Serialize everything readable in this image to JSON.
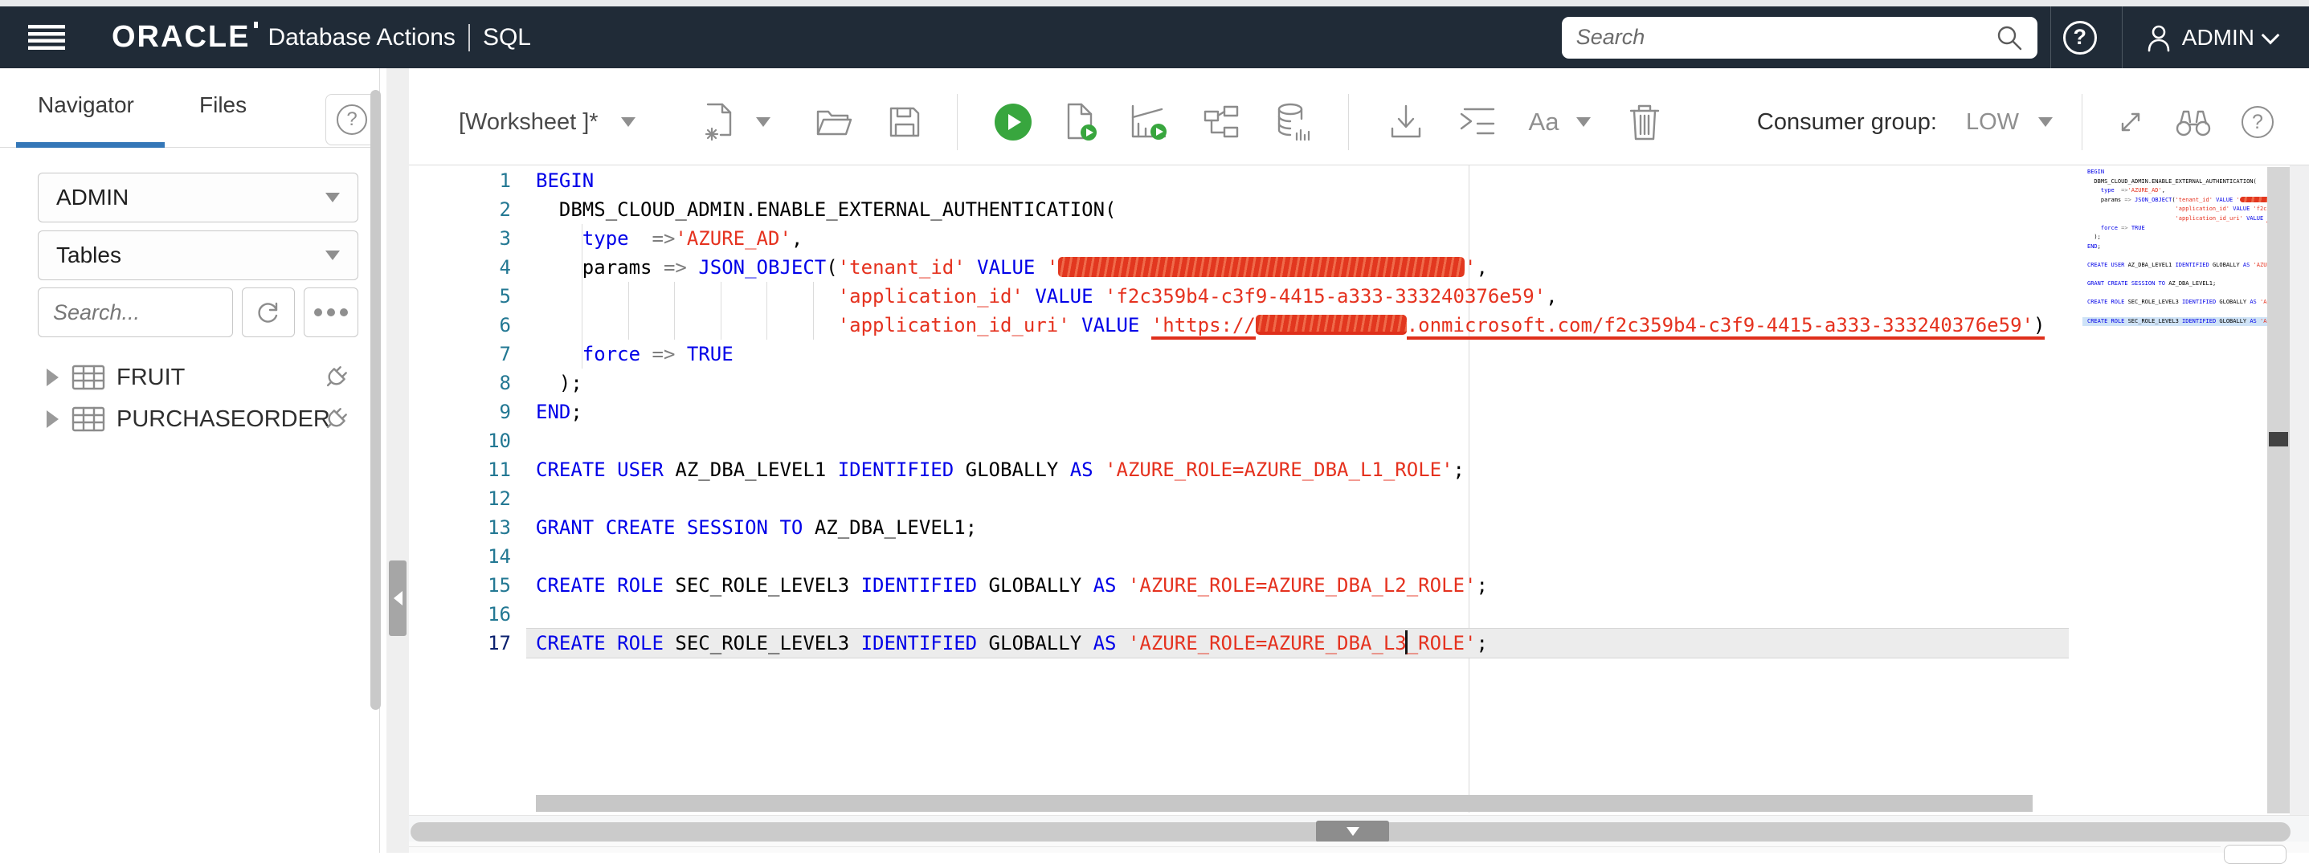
{
  "colors": {
    "header_bg": "#202b37",
    "tab_accent_blue": "#3477b8",
    "run_green": "#38a63e",
    "syntax_keyword": "#0000e8",
    "syntax_string": "#e5321f",
    "syntax_operator": "#7e7e7e",
    "line_number": "#237893",
    "line_number_active": "#0b216f",
    "redaction_red": "#e2371f",
    "current_line_bg": "#ececec"
  },
  "icons": {
    "question": "?"
  },
  "header": {
    "brand": "ORACLE",
    "app_title": "Database Actions",
    "section": "SQL",
    "search_placeholder": "Search",
    "user": "ADMIN"
  },
  "sidebar": {
    "tabs": [
      {
        "label": "Navigator"
      },
      {
        "label": "Files"
      }
    ],
    "schema": "ADMIN",
    "object_type": "Tables",
    "search_placeholder": "Search...",
    "tree": [
      {
        "label": "FRUIT"
      },
      {
        "label": "PURCHASEORDER"
      }
    ]
  },
  "toolbar": {
    "worksheet_label": "[Worksheet ]*",
    "font_size_label": "Aa",
    "consumer_group_label": "Consumer group:",
    "consumer_group_value": "LOW"
  },
  "editor": {
    "active_line": 17,
    "lines": [
      [
        [
          "kw",
          "BEGIN"
        ]
      ],
      [
        [
          "pl",
          "  DBMS_CLOUD_ADMIN.ENABLE_EXTERNAL_AUTHENTICATION("
        ]
      ],
      [
        [
          "pl",
          "    "
        ],
        [
          "kw",
          "type"
        ],
        [
          "pl",
          "  "
        ],
        [
          "op",
          "=>"
        ],
        [
          "str",
          "'AZURE_AD'"
        ],
        [
          "pl",
          ","
        ]
      ],
      [
        [
          "pl",
          "    params "
        ],
        [
          "op",
          "=>"
        ],
        [
          "pl",
          " "
        ],
        [
          "kw",
          "JSON_OBJECT"
        ],
        [
          "pl",
          "("
        ],
        [
          "str",
          "'tenant_id'"
        ],
        [
          "pl",
          " "
        ],
        [
          "kw",
          "VALUE"
        ],
        [
          "pl",
          " "
        ],
        [
          "str",
          "'"
        ],
        [
          "redact",
          "35"
        ],
        [
          "str",
          "'"
        ],
        [
          "pl",
          ","
        ]
      ],
      [
        [
          "pl",
          "                          "
        ],
        [
          "str",
          "'application_id'"
        ],
        [
          "pl",
          " "
        ],
        [
          "kw",
          "VALUE"
        ],
        [
          "pl",
          " "
        ],
        [
          "str",
          "'f2c359b4-c3f9-4415-a333-333240376e59'"
        ],
        [
          "pl",
          ","
        ]
      ],
      [
        [
          "pl",
          "                          "
        ],
        [
          "str",
          "'application_id_uri'"
        ],
        [
          "pl",
          " "
        ],
        [
          "kw",
          "VALUE"
        ],
        [
          "pl",
          " "
        ],
        [
          "str",
          "'https://",
          "u"
        ],
        [
          "redact",
          "13",
          "u"
        ],
        [
          "str",
          ".onmicrosoft.com/f2c359b4-c3f9-4415-a333-333240376e59'",
          "u"
        ],
        [
          "pl",
          ")",
          "u"
        ]
      ],
      [
        [
          "pl",
          "    "
        ],
        [
          "kw",
          "force"
        ],
        [
          "pl",
          " "
        ],
        [
          "op",
          "=>"
        ],
        [
          "pl",
          " "
        ],
        [
          "kw",
          "TRUE"
        ]
      ],
      [
        [
          "pl",
          "  );"
        ]
      ],
      [
        [
          "kw",
          "END"
        ],
        [
          "pl",
          ";"
        ]
      ],
      [],
      [
        [
          "kw",
          "CREATE"
        ],
        [
          "pl",
          " "
        ],
        [
          "kw",
          "USER"
        ],
        [
          "pl",
          " AZ_DBA_LEVEL1 "
        ],
        [
          "kw",
          "IDENTIFIED"
        ],
        [
          "pl",
          " GLOBALLY "
        ],
        [
          "kw",
          "AS"
        ],
        [
          "pl",
          " "
        ],
        [
          "str",
          "'AZURE_ROLE=AZURE_DBA_L1_ROLE'"
        ],
        [
          "pl",
          ";"
        ]
      ],
      [],
      [
        [
          "kw",
          "GRANT"
        ],
        [
          "pl",
          " "
        ],
        [
          "kw",
          "CREATE"
        ],
        [
          "pl",
          " "
        ],
        [
          "kw",
          "SESSION"
        ],
        [
          "pl",
          " "
        ],
        [
          "kw",
          "TO"
        ],
        [
          "pl",
          " AZ_DBA_LEVEL1;"
        ]
      ],
      [],
      [
        [
          "kw",
          "CREATE"
        ],
        [
          "pl",
          " "
        ],
        [
          "kw",
          "ROLE"
        ],
        [
          "pl",
          " SEC_ROLE_LEVEL3 "
        ],
        [
          "kw",
          "IDENTIFIED"
        ],
        [
          "pl",
          " GLOBALLY "
        ],
        [
          "kw",
          "AS"
        ],
        [
          "pl",
          " "
        ],
        [
          "str",
          "'AZURE_ROLE=AZURE_DBA_L2_ROLE'"
        ],
        [
          "pl",
          ";"
        ]
      ],
      [],
      [
        [
          "kw",
          "CREATE"
        ],
        [
          "pl",
          " "
        ],
        [
          "kw",
          "ROLE"
        ],
        [
          "pl",
          " SEC_ROLE_LEVEL3 "
        ],
        [
          "kw",
          "IDENTIFIED"
        ],
        [
          "pl",
          " GLOBALLY "
        ],
        [
          "kw",
          "AS"
        ],
        [
          "pl",
          " "
        ],
        [
          "str",
          "'AZURE_ROLE=AZURE_DBA_L3"
        ],
        [
          "caret",
          ""
        ],
        [
          "str",
          "_ROLE'"
        ],
        [
          "pl",
          ";"
        ]
      ]
    ]
  }
}
